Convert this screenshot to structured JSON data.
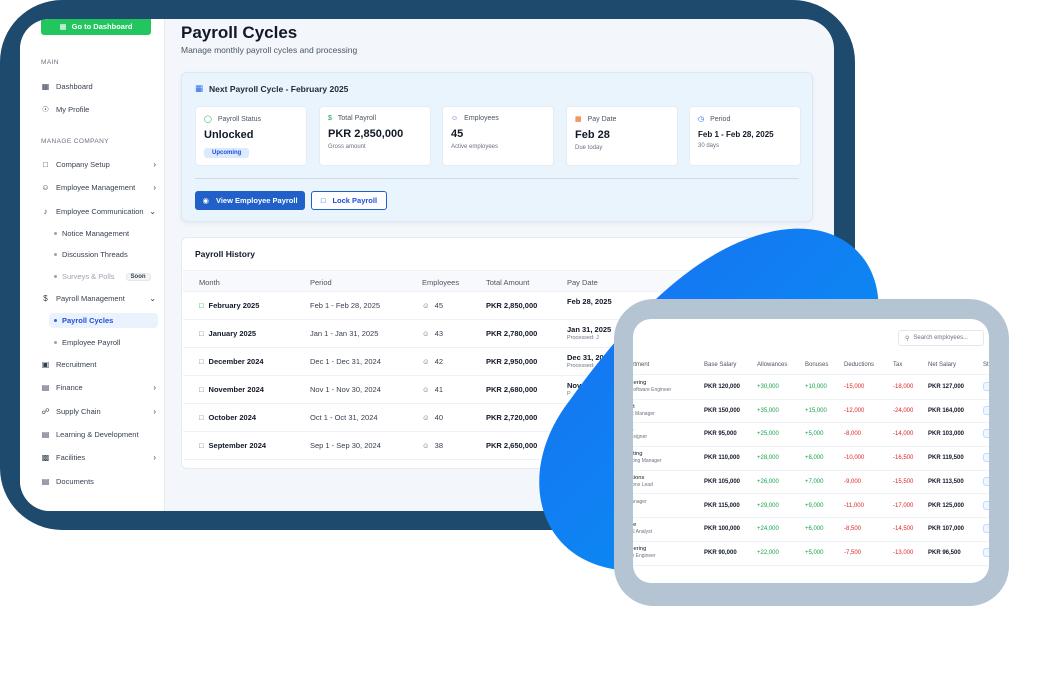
{
  "sidebar": {
    "dashboard_button": "Go to Dashboard",
    "main_heading": "MAIN",
    "main_items": [
      {
        "label": "Dashboard",
        "icon": "grid-icon"
      },
      {
        "label": "My Profile",
        "icon": "user-icon"
      }
    ],
    "manage_heading": "MANAGE COMPANY",
    "company_setup": "Company Setup",
    "employee_management": "Employee Management",
    "employee_communication": "Employee Communication",
    "notice_management": "Notice Management",
    "discussion_threads": "Discussion Threads",
    "surveys_polls": "Surveys & Polls",
    "soon_badge": "Soon",
    "payroll_management": "Payroll Management",
    "payroll_cycles": "Payroll Cycles",
    "employee_payroll": "Employee Payroll",
    "recruitment": "Recruitment",
    "finance": "Finance",
    "supply_chain": "Supply Chain",
    "learning_development": "Learning & Development",
    "facilities": "Facilities",
    "documents": "Documents"
  },
  "page": {
    "title": "Payroll Cycles",
    "subtitle": "Manage monthly payroll cycles and processing"
  },
  "next_cycle": {
    "title": "Next Payroll Cycle - February 2025",
    "stats": [
      {
        "label": "Payroll Status",
        "value": "Unlocked",
        "badge": "Upcoming",
        "icon": "lock-open-icon"
      },
      {
        "label": "Total Payroll",
        "value": "PKR 2,850,000",
        "note": "Gross amount",
        "icon": "dollar-icon"
      },
      {
        "label": "Employees",
        "value": "45",
        "note": "Active employees",
        "icon": "users-icon"
      },
      {
        "label": "Pay Date",
        "value": "Feb 28",
        "note": "Due today",
        "icon": "calendar-icon"
      },
      {
        "label": "Period",
        "value": "Feb 1 - Feb 28, 2025",
        "note": "30 days",
        "icon": "clock-icon"
      }
    ],
    "view_button": "View Employee Payroll",
    "lock_button": "Lock Payroll"
  },
  "history": {
    "title": "Payroll History",
    "columns": [
      "Month",
      "Period",
      "Employees",
      "Total Amount",
      "Pay Date"
    ],
    "rows": [
      {
        "month": "February 2025",
        "period": "Feb 1 - Feb 28, 2025",
        "employees": "45",
        "amount": "PKR 2,850,000",
        "pay_date": "Feb 28, 2025",
        "processed": ""
      },
      {
        "month": "January 2025",
        "period": "Jan 1 - Jan 31, 2025",
        "employees": "43",
        "amount": "PKR 2,780,000",
        "pay_date": "Jan 31, 2025",
        "processed": "Processed: J"
      },
      {
        "month": "December 2024",
        "period": "Dec 1 - Dec 31, 2024",
        "employees": "42",
        "amount": "PKR 2,950,000",
        "pay_date": "Dec 31, 2024",
        "processed": "Processed:"
      },
      {
        "month": "November 2024",
        "period": "Nov 1 - Nov 30, 2024",
        "employees": "41",
        "amount": "PKR 2,680,000",
        "pay_date": "Nov",
        "processed": "P"
      },
      {
        "month": "October 2024",
        "period": "Oct 1 - Oct 31, 2024",
        "employees": "40",
        "amount": "PKR 2,720,000",
        "pay_date": "Oc",
        "processed": ""
      },
      {
        "month": "September 2024",
        "period": "Sep 1 - Sep 30, 2024",
        "employees": "38",
        "amount": "PKR 2,650,000",
        "pay_date": "",
        "processed": ""
      }
    ]
  },
  "employee_payroll": {
    "search_placeholder": "Search employees...",
    "columns": [
      "artment",
      "Base Salary",
      "Allowances",
      "Bonuses",
      "Deductions",
      "Tax",
      "Net Salary",
      "St"
    ],
    "rows": [
      {
        "dept": "neering",
        "role": "r Software Engineer",
        "base": "PKR 120,000",
        "allow": "+30,000",
        "bonus": "+10,000",
        "ded": "-15,000",
        "tax": "-18,000",
        "net": "PKR 127,000"
      },
      {
        "dept": "uct",
        "role": "uct Manager",
        "base": "PKR 150,000",
        "allow": "+35,000",
        "bonus": "+15,000",
        "ded": "-12,000",
        "tax": "-24,000",
        "net": "PKR 164,000"
      },
      {
        "dept": "gn",
        "role": "Designer",
        "base": "PKR 95,000",
        "allow": "+25,000",
        "bonus": "+5,000",
        "ded": "-8,000",
        "tax": "-14,000",
        "net": "PKR 103,000"
      },
      {
        "dept": "keting",
        "role": "keting Manager",
        "base": "PKR 110,000",
        "allow": "+28,000",
        "bonus": "+8,000",
        "ded": "-10,000",
        "tax": "-16,500",
        "net": "PKR 119,500"
      },
      {
        "dept": "rations",
        "role": "ations Lead",
        "base": "PKR 105,000",
        "allow": "+26,000",
        "bonus": "+7,000",
        "ded": "-9,000",
        "tax": "-15,500",
        "net": "PKR 113,500"
      },
      {
        "dept": "",
        "role": "Manager",
        "base": "PKR 115,000",
        "allow": "+29,000",
        "bonus": "+9,000",
        "ded": "-11,000",
        "tax": "-17,000",
        "net": "PKR 125,000"
      },
      {
        "dept": "nce",
        "role": "cial Analyst",
        "base": "PKR 100,000",
        "allow": "+24,000",
        "bonus": "+6,000",
        "ded": "-8,500",
        "tax": "-14,500",
        "net": "PKR 107,000"
      },
      {
        "dept": "neering",
        "role": "are Engineer",
        "base": "PKR 90,000",
        "allow": "+22,000",
        "bonus": "+5,000",
        "ded": "-7,500",
        "tax": "-13,000",
        "net": "PKR 96,500"
      }
    ]
  },
  "colors": {
    "frame": "#1d4a6d",
    "accent_green": "#22c55e",
    "primary_blue": "#2060c8",
    "leaf_blue": "#0a7ef0"
  }
}
